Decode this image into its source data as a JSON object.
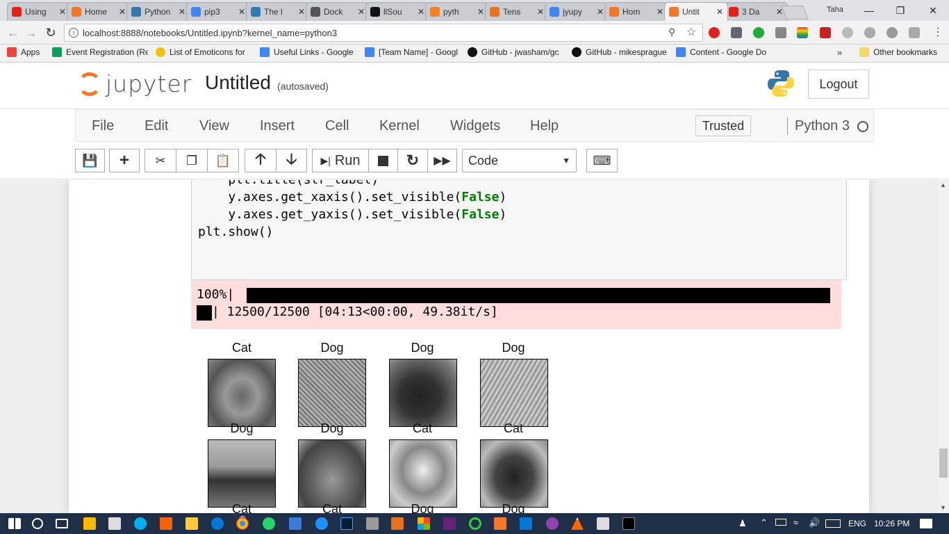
{
  "browser": {
    "tabs": [
      {
        "title": "Using",
        "color": "#e62117"
      },
      {
        "title": "Home",
        "color": "#f37726"
      },
      {
        "title": "Python",
        "color": "#3776ab"
      },
      {
        "title": "pip3",
        "color": "#4285f4"
      },
      {
        "title": "The l",
        "color": "#2e7db3"
      },
      {
        "title": "Dock",
        "color": "#555555"
      },
      {
        "title": "llSou",
        "color": "#111111"
      },
      {
        "title": "pyth",
        "color": "#f48024"
      },
      {
        "title": "Tens",
        "color": "#e8711c"
      },
      {
        "title": "jyupy",
        "color": "#4285f4"
      },
      {
        "title": "Hom",
        "color": "#f37726"
      },
      {
        "title": "Untit",
        "color": "#f37726"
      },
      {
        "title": "3 Da",
        "color": "#e62117"
      }
    ],
    "active_tab_index": 11,
    "user_name": "Taha",
    "url": "localhost:8888/notebooks/Untitled.ipynb?kernel_name=python3",
    "bookmarks": [
      {
        "label": "Apps",
        "color": "#e8453c"
      },
      {
        "label": "Event Registration (Re",
        "color": "#0f9d58"
      },
      {
        "label": "List of Emoticons for",
        "color": "#f4c20d"
      },
      {
        "label": "Useful Links - Google",
        "color": "#4285f4"
      },
      {
        "label": "[Team Name] - Googl",
        "color": "#4285f4"
      },
      {
        "label": "GitHub - jwasham/gc",
        "color": "#111111"
      },
      {
        "label": "GitHub - mikesprague",
        "color": "#111111"
      },
      {
        "label": "Content - Google Do",
        "color": "#4285f4"
      }
    ],
    "bookmarks_overflow": "»",
    "other_bookmarks": "Other bookmarks"
  },
  "jupyter": {
    "logo_text": "jupyter",
    "notebook_name": "Untitled",
    "autosave_status": "(autosaved)",
    "logout_label": "Logout",
    "menus": [
      "File",
      "Edit",
      "View",
      "Insert",
      "Cell",
      "Kernel",
      "Widgets",
      "Help"
    ],
    "trusted_label": "Trusted",
    "kernel_name": "Python 3",
    "run_label": "Run",
    "cell_type": "Code"
  },
  "cell": {
    "code_lines": [
      "    plt.title(str_label)",
      "    y.axes.get_xaxis().set_visible(",
      "    y.axes.get_yaxis().set_visible(",
      "plt.show()"
    ],
    "kw_false": "False",
    "close_paren": ")",
    "output_percent": "100%|",
    "output_line2": "| 12500/12500 [04:13<00:00, 49.38it/s]",
    "progress": 1.0
  },
  "figure": {
    "titles": [
      "Cat",
      "Dog",
      "Dog",
      "Dog",
      "Dog",
      "Dog",
      "Cat",
      "Cat"
    ],
    "bottom_titles": [
      "Cat",
      "Cat",
      "Dog",
      "Dog"
    ]
  },
  "taskbar": {
    "language": "ENG",
    "time": "10:26 PM"
  }
}
